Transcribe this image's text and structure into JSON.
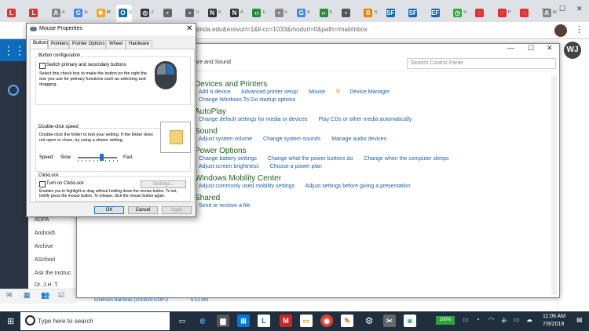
{
  "browser": {
    "tabs": [
      {
        "fav": "L",
        "color": "#d33",
        "title": ""
      },
      {
        "fav": "L",
        "color": "#d33",
        "title": ""
      },
      {
        "fav": "A",
        "color": "#888",
        "title": "A"
      },
      {
        "fav": "G",
        "color": "#4285f4",
        "title": "si"
      },
      {
        "fav": "✸",
        "color": "#f5a623",
        "title": "M"
      },
      {
        "fav": "O",
        "color": "#0f6cbd",
        "title": "C"
      },
      {
        "fav": "◎",
        "color": "#333",
        "title": "2"
      },
      {
        "fav": "▪",
        "color": "#666",
        "title": ""
      },
      {
        "fav": "▪",
        "color": "#666",
        "title": "U"
      },
      {
        "fav": "N",
        "color": "#333",
        "title": "A"
      },
      {
        "fav": "N",
        "color": "#333",
        "title": "A"
      },
      {
        "fav": "‹›",
        "color": "#2a8b3a",
        "title": "C"
      },
      {
        "fav": "▪",
        "color": "#888",
        "title": "c"
      },
      {
        "fav": "G",
        "color": "#4285f4",
        "title": "e"
      },
      {
        "fav": "‹›",
        "color": "#2a8b3a",
        "title": "fi"
      },
      {
        "fav": "▪",
        "color": "#555",
        "title": ""
      },
      {
        "fav": "B",
        "color": "#f57c00",
        "title": "S"
      },
      {
        "fav": "SF",
        "color": "#1565c0",
        "title": ""
      },
      {
        "fav": "SF",
        "color": "#1565c0",
        "title": ""
      },
      {
        "fav": "EF",
        "color": "#1565c0",
        "title": ""
      },
      {
        "fav": "◷",
        "color": "#3a3",
        "title": "S"
      },
      {
        "fav": "◌",
        "color": "#d33",
        "title": ""
      },
      {
        "fav": "◌",
        "color": "#d33",
        "title": "P"
      },
      {
        "fav": "◌",
        "color": "#d33",
        "title": ""
      },
      {
        "fav": "A",
        "color": "#888",
        "title": "lic"
      }
    ],
    "url": "florida.edu&exsvurl=1&ll-cc=1033&modurl=0&path=/mail/inbox"
  },
  "outlook": {
    "folders": [
      "ADPA",
      "Android\\",
      "Archive",
      "ASchool",
      "Ask the Instruc",
      "Dr. J.H. T."
    ],
    "avatar_initials": "WJ",
    "email_sender": "Emerson Barreras (2019/20-COP-2",
    "email_time": "6:12 AM"
  },
  "control_panel": {
    "breadcrumb": "are and Sound",
    "search_placeholder": "Search Control Panel",
    "sections": [
      {
        "title": "Devices and Printers",
        "links": [
          "Add a device",
          "Advanced printer setup",
          "Mouse",
          "Device Manager"
        ],
        "links2": [
          "Change Windows To Go startup options"
        ]
      },
      {
        "title": "AutoPlay",
        "links": [
          "Change default settings for media or devices",
          "Play CDs or other media automatically"
        ],
        "links2": []
      },
      {
        "title": "Sound",
        "links": [
          "Adjust system volume",
          "Change system sounds",
          "Manage audio devices"
        ],
        "links2": []
      },
      {
        "title": "Power Options",
        "links": [
          "Change battery settings",
          "Change what the power buttons do",
          "Change when the computer sleeps"
        ],
        "links2": [
          "Adjust screen brightness",
          "Choose a power plan"
        ]
      },
      {
        "title": "Windows Mobility Center",
        "links": [
          "Adjust commonly used mobility settings",
          "Adjust settings before giving a presentation"
        ],
        "links2": []
      },
      {
        "title": "Shared",
        "links": [
          "Send or receive a file"
        ],
        "links2": []
      }
    ]
  },
  "mouse_dialog": {
    "title": "Mouse Properties",
    "tabs": [
      "Buttons",
      "Pointers",
      "Pointer Options",
      "Wheel",
      "Hardware"
    ],
    "button_config": {
      "label": "Button configuration",
      "checkbox": "Switch primary and secondary buttons",
      "description": "Select this check box to make the button on the right the one you use for primary functions such as selecting and dragging."
    },
    "double_click": {
      "label": "Double-click speed",
      "description": "Double-click the folder to test your setting. If the folder does not open or close, try using a slower setting.",
      "speed_label": "Speed:",
      "slow": "Slow",
      "fast": "Fast",
      "speed_level": 0.6
    },
    "clicklock": {
      "label": "ClickLock",
      "checkbox": "Turn on ClickLock",
      "settings_button": "Settings...",
      "description": "Enables you to highlight or drag without holding down the mouse button. To set, briefly press the mouse button. To release, click the mouse button again."
    },
    "buttons": {
      "ok": "OK",
      "cancel": "Cancel",
      "apply": "Apply"
    }
  },
  "taskbar": {
    "search_placeholder": "Type here to search",
    "battery": "100%",
    "time": "11:06 AM",
    "date": "7/9/2019"
  }
}
